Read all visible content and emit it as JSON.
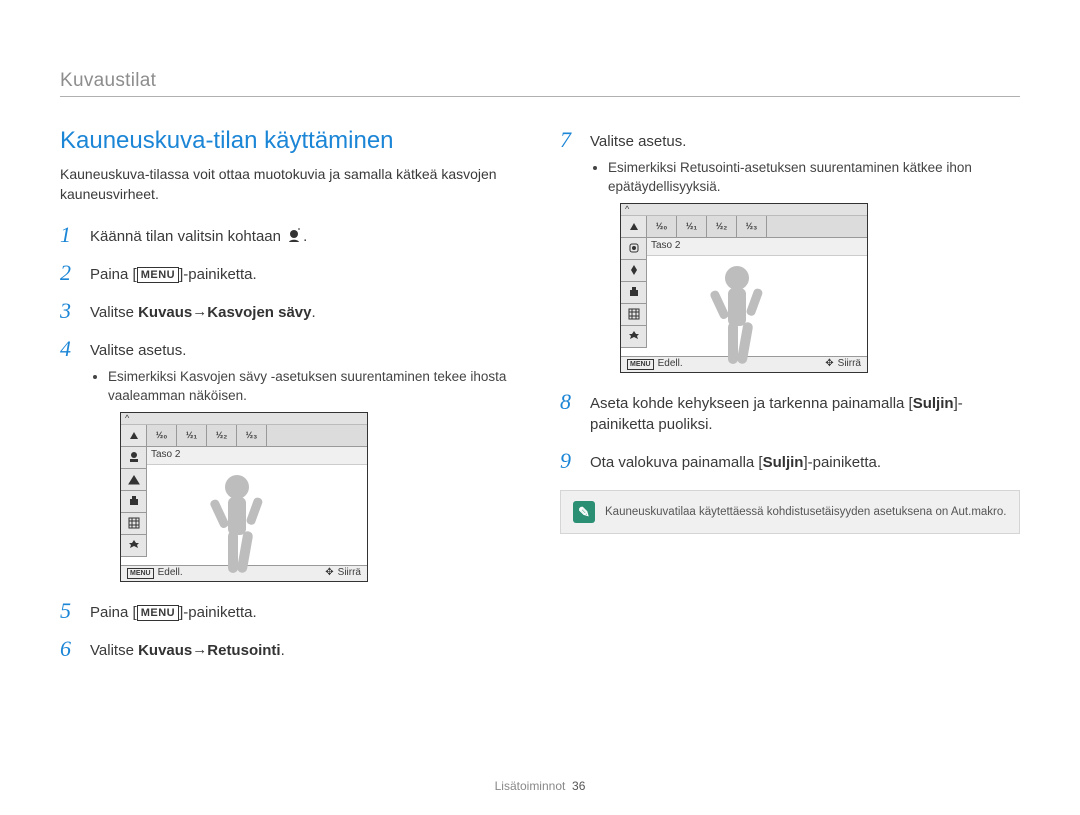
{
  "section": "Kuvaustilat",
  "title": "Kauneuskuva-tilan käyttäminen",
  "intro": "Kauneuskuva-tilassa voit ottaa muotokuvia ja samalla kätkeä kasvojen kauneusvirheet.",
  "steps": {
    "s1": {
      "num": "1",
      "prefix": "Käännä tilan valitsin kohtaan ",
      "suffix": "."
    },
    "s2": {
      "num": "2",
      "prefix": "Paina [",
      "label": "MENU",
      "suffix": "]-painiketta."
    },
    "s3": {
      "num": "3",
      "prefix": "Valitse ",
      "bold1": "Kuvaus",
      "arrow": " → ",
      "bold2": "Kasvojen sävy",
      "suffix": "."
    },
    "s4": {
      "num": "4",
      "text": "Valitse asetus.",
      "bullet": "Esimerkiksi Kasvojen sävy -asetuksen suurentaminen tekee ihosta vaaleamman näköisen."
    },
    "s5": {
      "num": "5",
      "prefix": "Paina [",
      "label": "MENU",
      "suffix": "]-painiketta."
    },
    "s6": {
      "num": "6",
      "prefix": "Valitse ",
      "bold1": "Kuvaus",
      "arrow": " → ",
      "bold2": "Retusointi",
      "suffix": "."
    },
    "s7": {
      "num": "7",
      "text": "Valitse asetus.",
      "bullet": "Esimerkiksi Retusointi-asetuksen suurentaminen kätkee ihon epätäydellisyyksiä."
    },
    "s8": {
      "num": "8",
      "part1": "Aseta kohde kehykseen ja tarkenna painamalla [",
      "bold": "Suljin",
      "part2": "]-painiketta puoliksi."
    },
    "s9": {
      "num": "9",
      "part1": "Ota valokuva painamalla [",
      "bold": "Suljin",
      "part2": "]-painiketta."
    }
  },
  "preview": {
    "level": "Taso 2",
    "back": "Edell.",
    "move": "Siirrä",
    "menu": "MENU",
    "opts": [
      "½₀",
      "½₁",
      "½₂",
      "½₃"
    ]
  },
  "infobox": "Kauneuskuvatilaa käytettäessä kohdistusetäisyyden asetuksena on Aut.makro.",
  "footer_label": "Lisätoiminnot",
  "page_number": "36"
}
